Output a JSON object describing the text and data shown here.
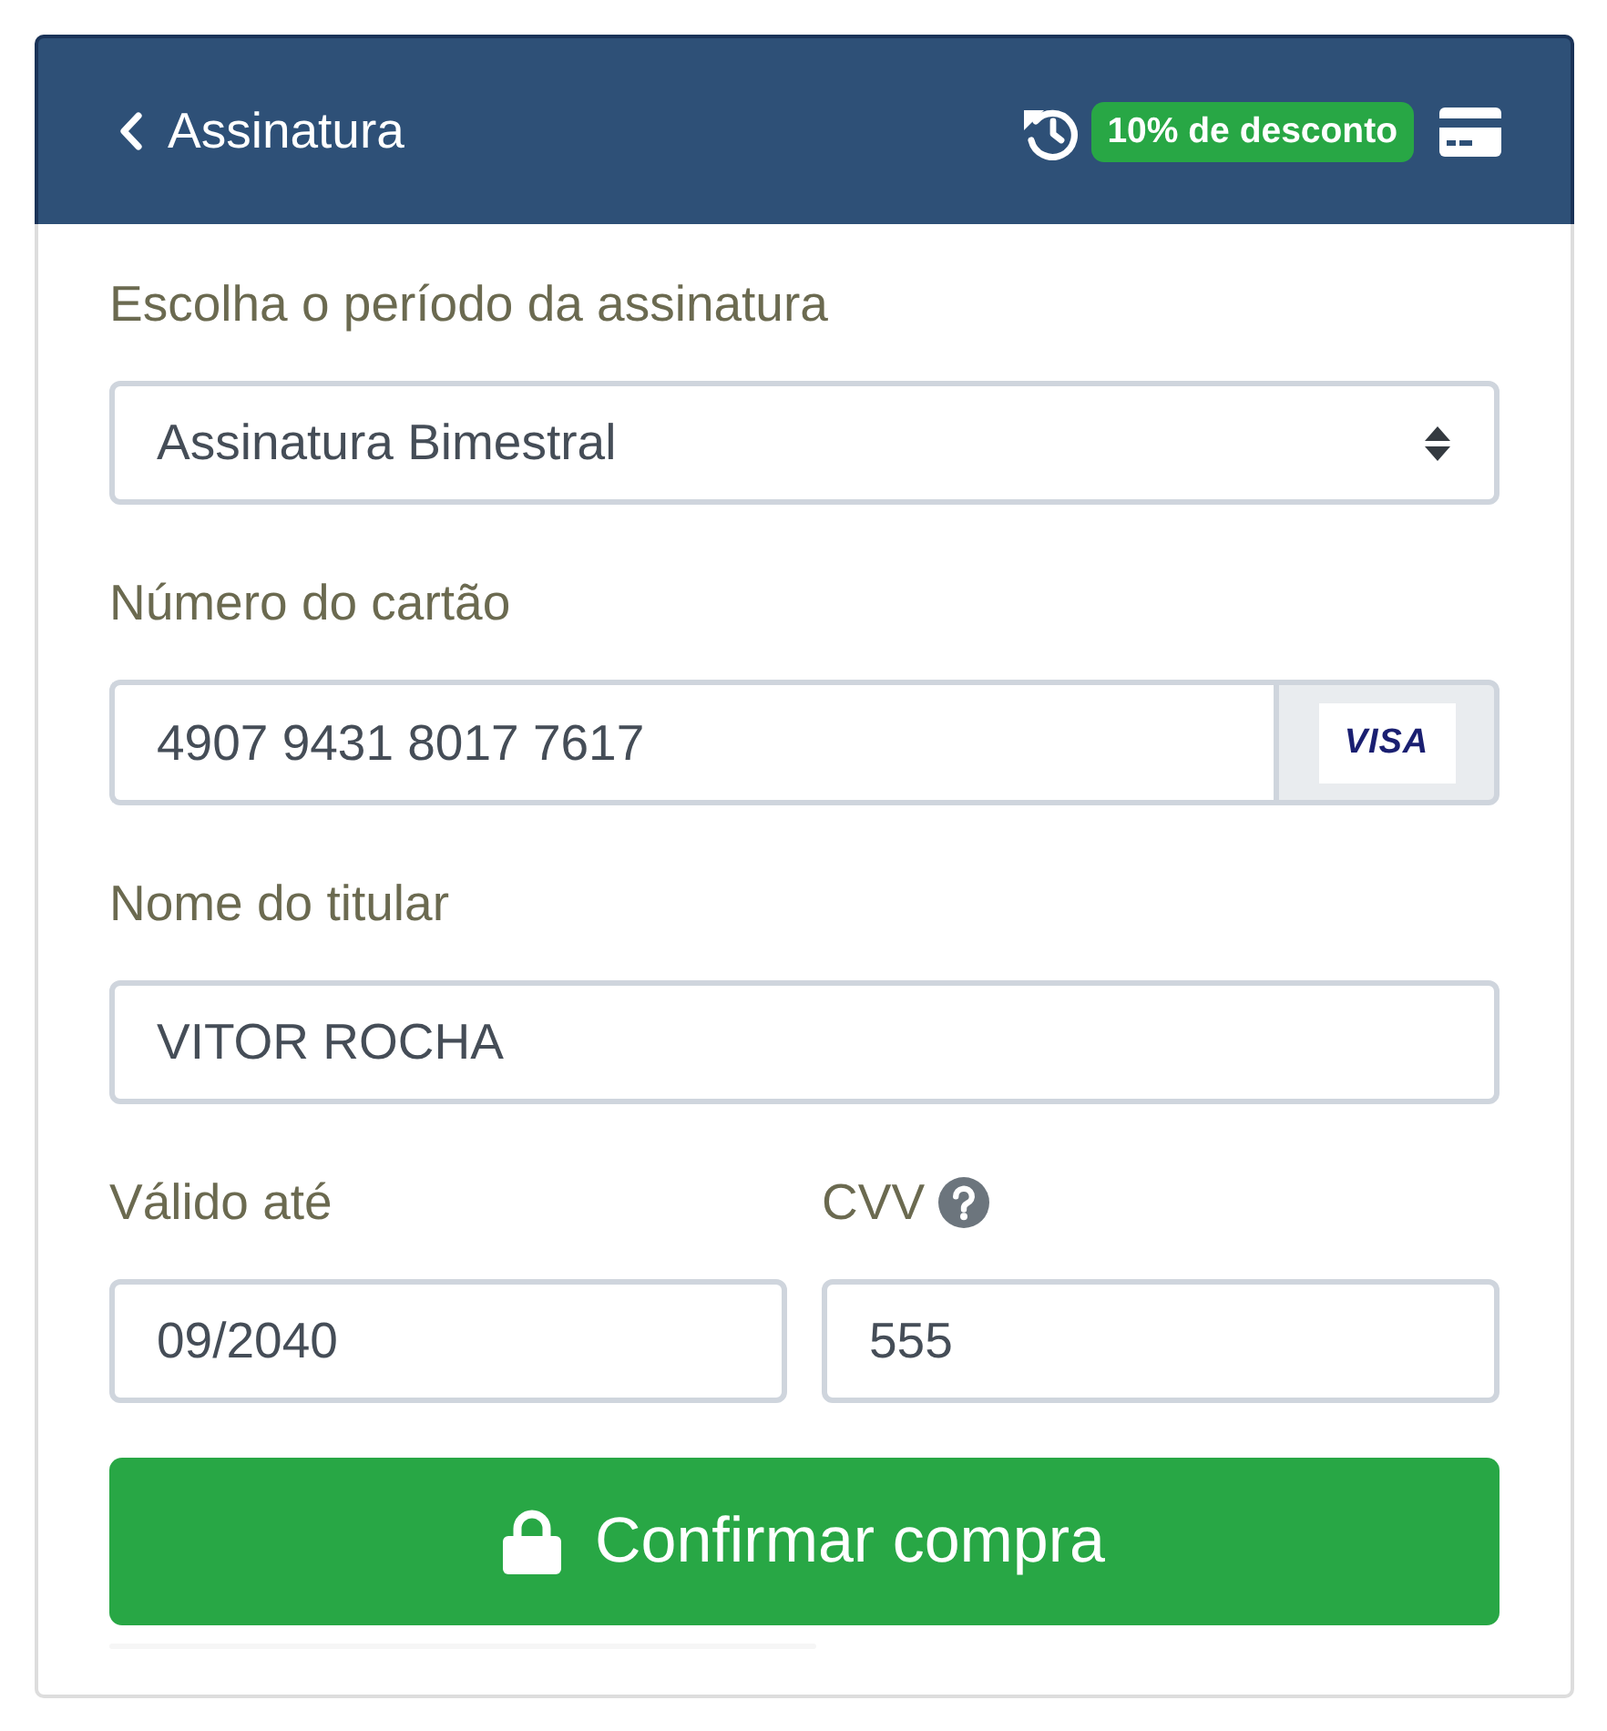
{
  "header": {
    "back_link": "Assinatura",
    "discount_badge": "10% de desconto"
  },
  "fields": [
    {
      "kind": "select",
      "label": "Escolha o período da assinatura",
      "value": "Assinatura Bimestral"
    },
    {
      "kind": "card",
      "label": "Número do cartão",
      "value": "4907 9431 8017 7617",
      "brand": "VISA"
    },
    {
      "kind": "text",
      "label": "Nome do titular",
      "value": "VITOR ROCHA"
    }
  ],
  "row_fields": [
    {
      "kind": "text",
      "label": "Válido até",
      "value": "09/2040"
    },
    {
      "kind": "cvv",
      "label": "CVV",
      "value": "555"
    }
  ],
  "submit_button": "Confirmar compra"
}
